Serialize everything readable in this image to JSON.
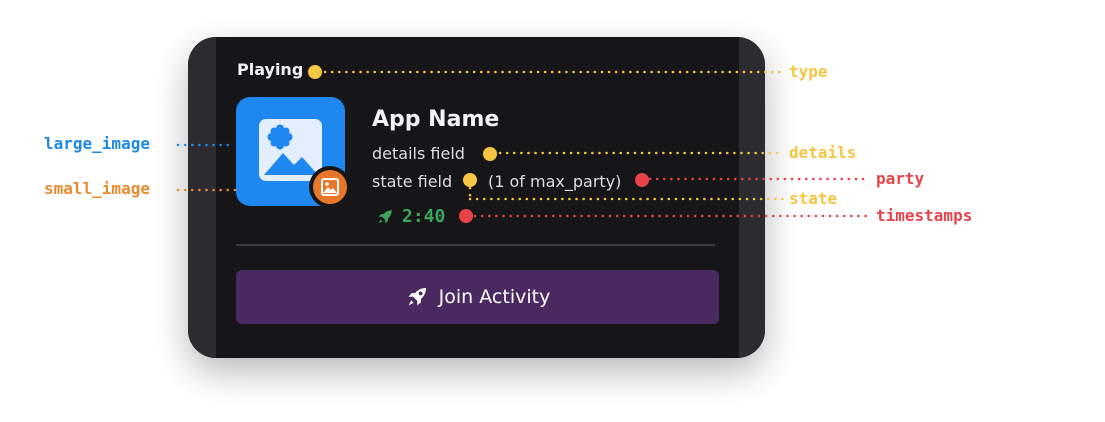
{
  "card": {
    "type_label": "Playing",
    "app_name": "App Name",
    "details": "details field",
    "state": "state field",
    "party": "(1 of max_party)",
    "timer": "2:40",
    "join_button_label": "Join Activity",
    "icons": {
      "large_image": "image-placeholder-icon",
      "small_image": "image-icon",
      "timer": "rocket-icon",
      "join": "rocket-icon"
    }
  },
  "annotations": {
    "type": "type",
    "details": "details",
    "party": "party",
    "state": "state",
    "timestamps": "timestamps",
    "large_image": "large_image",
    "small_image": "small_image"
  },
  "colors": {
    "card_background": "#161618",
    "join_button": "#4a2960",
    "large_image": "#1f87f0",
    "small_image": "#e8762b",
    "timer_green": "#3ba55d",
    "annotation_yellow": "#f5c643",
    "annotation_red": "#e9434a",
    "annotation_blue": "#1e88e5",
    "annotation_orange": "#ec8a2f"
  }
}
